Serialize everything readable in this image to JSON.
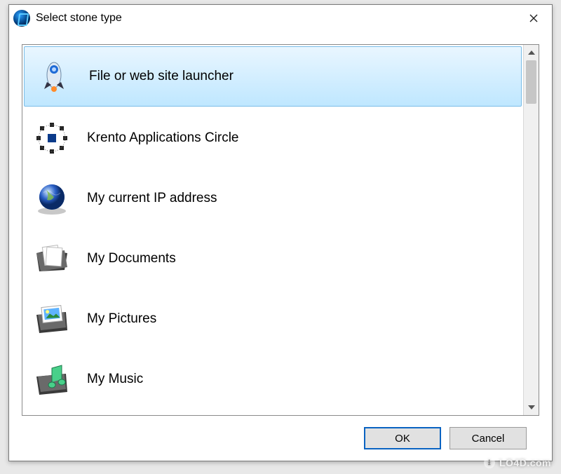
{
  "window": {
    "title": "Select stone type"
  },
  "list": {
    "items": [
      {
        "label": "File or web site launcher",
        "icon": "rocket-icon",
        "selected": true
      },
      {
        "label": "Krento Applications Circle",
        "icon": "app-circle-icon",
        "selected": false
      },
      {
        "label": "My current IP address",
        "icon": "globe-icon",
        "selected": false
      },
      {
        "label": "My Documents",
        "icon": "documents-folder-icon",
        "selected": false
      },
      {
        "label": "My Pictures",
        "icon": "pictures-folder-icon",
        "selected": false
      },
      {
        "label": "My Music",
        "icon": "music-folder-icon",
        "selected": false
      }
    ]
  },
  "buttons": {
    "ok": "OK",
    "cancel": "Cancel"
  },
  "watermark": "LO4D.com"
}
